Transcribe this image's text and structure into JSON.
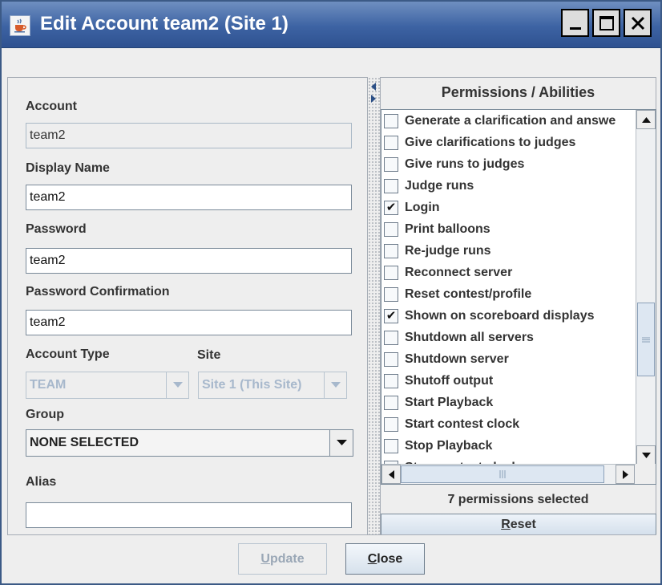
{
  "window": {
    "title": "Edit Account team2 (Site 1)",
    "controls": {
      "minimize": "_",
      "maximize": "☐",
      "close": "✕"
    }
  },
  "form": {
    "account_label": "Account",
    "account_value": "team2",
    "display_name_label": "Display Name",
    "display_name_value": "team2",
    "password_label": "Password",
    "password_value": "team2",
    "password_confirm_label": "Password Confirmation",
    "password_confirm_value": "team2",
    "account_type_label": "Account Type",
    "account_type_value": "TEAM",
    "site_label": "Site",
    "site_value": "Site 1 (This Site)",
    "group_label": "Group",
    "group_value": "NONE SELECTED",
    "alias_label": "Alias",
    "alias_value": ""
  },
  "permissions": {
    "header": "Permissions / Abilities",
    "items": [
      {
        "label": "Generate a clarification and answe",
        "checked": false
      },
      {
        "label": "Give clarifications to judges",
        "checked": false
      },
      {
        "label": "Give runs to judges",
        "checked": false
      },
      {
        "label": "Judge runs",
        "checked": false
      },
      {
        "label": "Login",
        "checked": true
      },
      {
        "label": "Print balloons",
        "checked": false
      },
      {
        "label": "Re-judge runs",
        "checked": false
      },
      {
        "label": "Reconnect server",
        "checked": false
      },
      {
        "label": "Reset contest/profile",
        "checked": false
      },
      {
        "label": "Shown on scoreboard displays",
        "checked": true
      },
      {
        "label": "Shutdown all servers",
        "checked": false
      },
      {
        "label": "Shutdown server",
        "checked": false
      },
      {
        "label": "Shutoff output",
        "checked": false
      },
      {
        "label": "Start Playback",
        "checked": false
      },
      {
        "label": "Start contest clock",
        "checked": false
      },
      {
        "label": "Stop Playback",
        "checked": false
      },
      {
        "label": "Stop contest clock",
        "checked": false
      }
    ],
    "count_text": "7 permissions selected",
    "reset_mnemonic": "R",
    "reset_rest": "eset"
  },
  "buttons": {
    "update_mnemonic": "U",
    "update_rest": "pdate",
    "update_enabled": false,
    "close_mnemonic": "C",
    "close_rest": "lose"
  },
  "icons": {
    "app": "java-cup-icon",
    "dropdown": "triangle-down-icon",
    "checkmark": "✔"
  },
  "colors": {
    "titlebar": "#3d63a3",
    "window_bg": "#eeeeee",
    "disabled_text": "#a7b8cc",
    "button_grad_end": "#d6e1ec"
  }
}
